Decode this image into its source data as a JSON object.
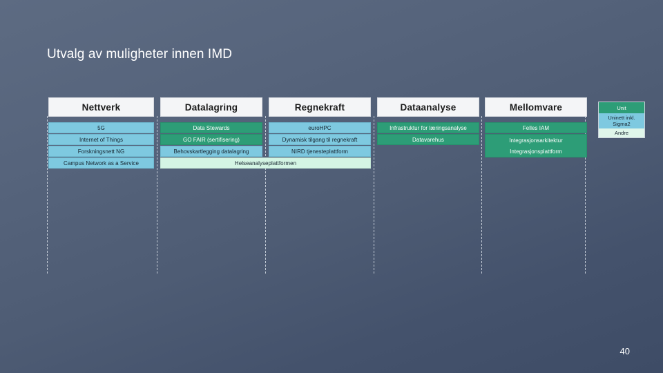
{
  "slide": {
    "title": "Utvalg av muligheter innen IMD",
    "page_number": "40"
  },
  "colors": {
    "unit_green": "#2d9d77",
    "uninett_blue": "#7ec9e0",
    "andre_mint": "#d4f5e4",
    "background_top": "#5d6b82",
    "background_bottom": "#3e4c66",
    "header_box": "#f4f5f7"
  },
  "legend": {
    "items": [
      {
        "label": "Unit",
        "color_key": "unit_green"
      },
      {
        "label": "Uninett inkl. Sigma2",
        "color_key": "uninett_blue"
      },
      {
        "label": "Andre",
        "color_key": "andre_mint"
      }
    ]
  },
  "matrix": {
    "columns": [
      {
        "header": "Nettverk",
        "items": [
          {
            "label": "5G",
            "color_key": "uninett_blue"
          },
          {
            "label": "Internet of Things",
            "color_key": "uninett_blue"
          },
          {
            "label": "Forskningsnett NG",
            "color_key": "uninett_blue"
          },
          {
            "label": "Campus Network as a Service",
            "color_key": "uninett_blue"
          }
        ]
      },
      {
        "header": "Datalagring",
        "items": [
          {
            "label": "Data Stewards",
            "color_key": "unit_green"
          },
          {
            "label": "GO FAIR (sertifisering)",
            "color_key": "unit_green"
          },
          {
            "label": "Behovskartlegging datalagring",
            "color_key": "uninett_blue"
          }
        ]
      },
      {
        "header": "Regnekraft",
        "items": [
          {
            "label": "euroHPC",
            "color_key": "uninett_blue"
          },
          {
            "label": "Dynamisk tilgang til regnekraft",
            "color_key": "uninett_blue"
          },
          {
            "label": "NIRD tjenesteplattform",
            "color_key": "uninett_blue"
          }
        ]
      },
      {
        "header": "Dataanalyse",
        "items": [
          {
            "label": "Infrastruktur for læringsanalyse",
            "color_key": "unit_green"
          },
          {
            "label": "Datavarehus",
            "color_key": "unit_green"
          }
        ]
      },
      {
        "header": "Mellomvare",
        "items": [
          {
            "label": "Felles IAM",
            "color_key": "unit_green"
          },
          {
            "label": "Integrasjonsarkitektur",
            "color_key": "unit_green"
          },
          {
            "label": "Integrasjonsplattform",
            "color_key": "unit_green"
          }
        ]
      }
    ],
    "spanning_items": [
      {
        "label": "Helseanalyseplattformen",
        "color_key": "andre_mint",
        "spans": "Datalagring-Regnekraft"
      }
    ]
  }
}
